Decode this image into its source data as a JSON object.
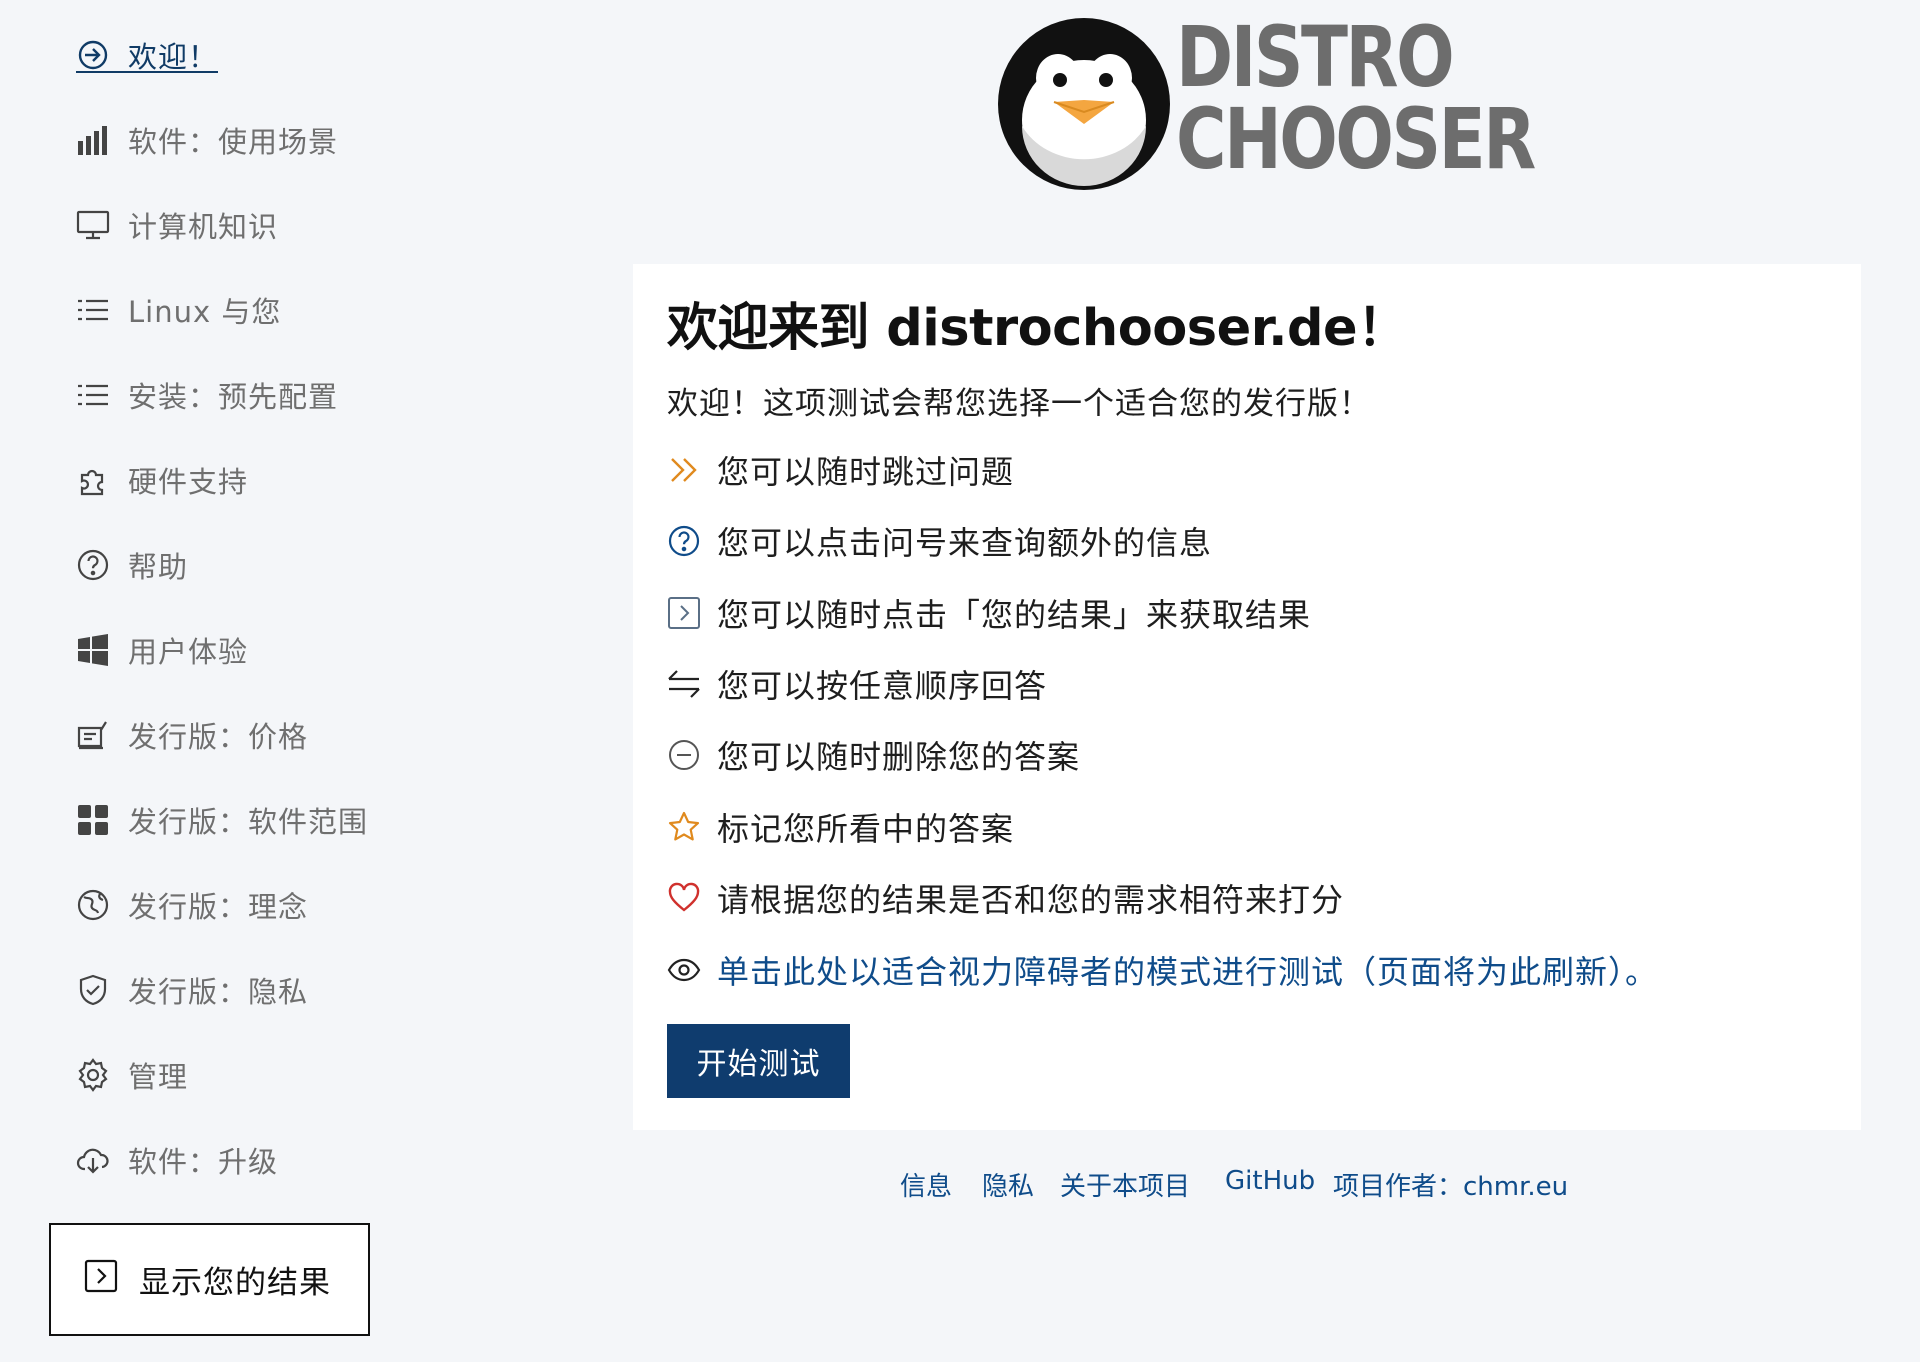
{
  "sidebar": {
    "items": [
      {
        "label": "欢迎！",
        "icon": "sign-in-icon",
        "active": true
      },
      {
        "label": "软件：使用场景",
        "icon": "bar-chart-icon"
      },
      {
        "label": "计算机知识",
        "icon": "monitor-icon"
      },
      {
        "label": "Linux 与您",
        "icon": "list-icon"
      },
      {
        "label": "安装：预先配置",
        "icon": "list-icon"
      },
      {
        "label": "硬件支持",
        "icon": "puzzle-icon"
      },
      {
        "label": "帮助",
        "icon": "question-circle-icon"
      },
      {
        "label": "用户体验",
        "icon": "windows-icon"
      },
      {
        "label": "发行版：价格",
        "icon": "cash-register-icon"
      },
      {
        "label": "发行版：软件范围",
        "icon": "grid-icon"
      },
      {
        "label": "发行版：理念",
        "icon": "globe-icon"
      },
      {
        "label": "发行版：隐私",
        "icon": "shield-icon"
      },
      {
        "label": "管理",
        "icon": "gear-icon"
      },
      {
        "label": "软件：升级",
        "icon": "cloud-download-icon"
      }
    ],
    "results_button": "显示您的结果"
  },
  "logo": {
    "line1": "DISTRO",
    "line2": "CHOOSER"
  },
  "card": {
    "title": "欢迎来到 distrochooser.de！",
    "intro": "欢迎！这项测试会帮您选择一个适合您的发行版！",
    "features": [
      {
        "text": "您可以随时跳过问题",
        "icon": "double-chevron-right-icon"
      },
      {
        "text": "您可以点击问号来查询额外的信息",
        "icon": "question-circle-icon"
      },
      {
        "text": "您可以随时点击「您的结果」来获取结果",
        "icon": "chevron-right-square-icon"
      },
      {
        "text": "您可以按任意顺序回答",
        "icon": "arrows-left-right-icon"
      },
      {
        "text": "您可以随时删除您的答案",
        "icon": "minus-circle-icon"
      },
      {
        "text": "标记您所看中的答案",
        "icon": "star-icon"
      },
      {
        "text": "请根据您的结果是否和您的需求相符来打分",
        "icon": "heart-icon"
      },
      {
        "text": "单击此处以适合视力障碍者的模式进行测试（页面将为此刷新）。",
        "icon": "eye-icon"
      }
    ],
    "start_button": "开始测试"
  },
  "footer": {
    "links": [
      "信息",
      "隐私",
      "关于本项目",
      "GitHub",
      "项目作者：chmr.eu"
    ]
  },
  "colors": {
    "background": "#f4f6f9",
    "accent": "#0f3c6e",
    "link": "#0f4c8a",
    "nav_text": "#6f6f6f",
    "star": "#e08a1e",
    "heart": "#d0312d"
  }
}
